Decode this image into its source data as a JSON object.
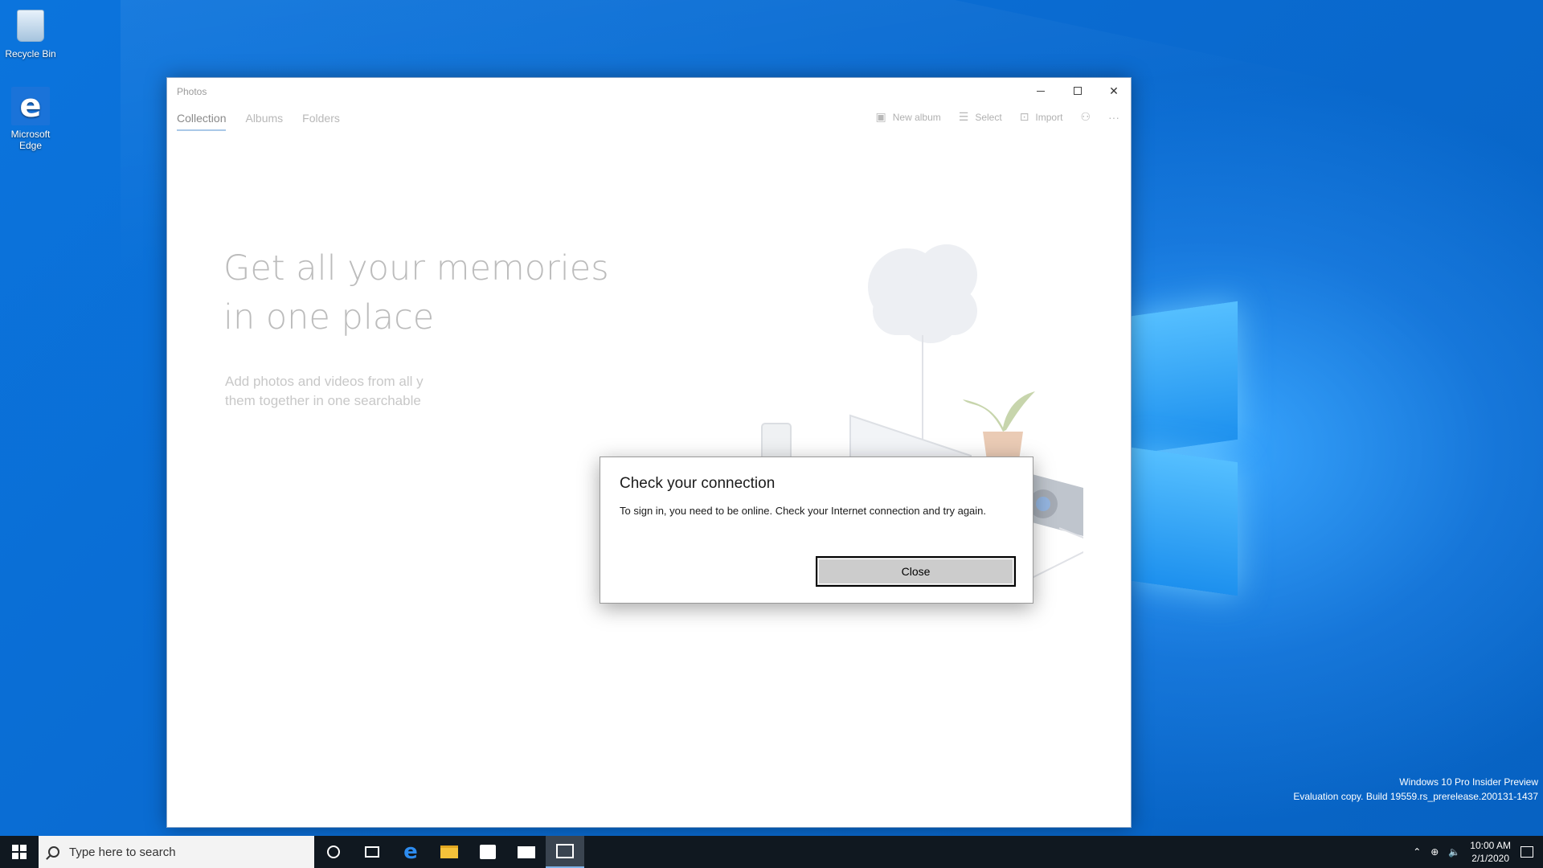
{
  "desktop": {
    "icons": [
      {
        "label": "Recycle Bin"
      },
      {
        "label": "Microsoft Edge"
      }
    ],
    "watermark": {
      "line1": "Windows 10 Pro Insider Preview",
      "line2": "Evaluation copy. Build 19559.rs_prerelease.200131-1437"
    }
  },
  "window": {
    "title": "Photos",
    "controls": {
      "minimize": "minimize-icon",
      "maximize": "maximize-icon",
      "close": "close-icon"
    },
    "tabs": [
      {
        "label": "Collection",
        "active": true
      },
      {
        "label": "Albums",
        "active": false
      },
      {
        "label": "Folders",
        "active": false
      }
    ],
    "toolbar": {
      "new_album": "New album",
      "select": "Select",
      "import": "Import",
      "account_icon": "person-icon",
      "more_icon": "ellipsis-icon"
    },
    "hero": {
      "title_line1": "Get all your memories",
      "title_line2": "in one place",
      "subtitle_line1": "Add photos and videos from all y",
      "subtitle_line2": "them together in one searchable"
    }
  },
  "dialog": {
    "title": "Check your connection",
    "message": "To sign in, you need to be online. Check your Internet connection and try again.",
    "button": "Close"
  },
  "taskbar": {
    "search_placeholder": "Type here to search",
    "pinned": [
      "cortana-icon",
      "task-view-icon",
      "edge-icon",
      "file-explorer-icon",
      "store-icon",
      "mail-icon",
      "photos-icon"
    ],
    "active_app": "photos-icon",
    "clock": {
      "time": "10:00 AM",
      "date": "2/1/2020"
    }
  },
  "colors": {
    "desktop_blue": "#0a6fd6",
    "taskbar": "#101820",
    "dialog_button": "#cccccc"
  }
}
